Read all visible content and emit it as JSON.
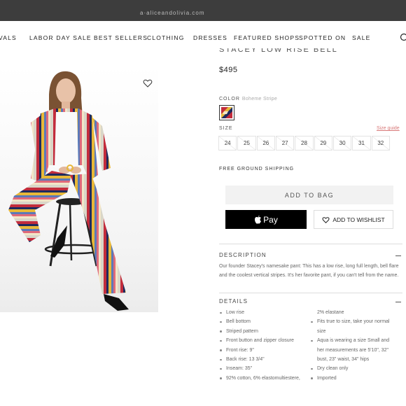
{
  "topbar": {
    "text": "a·aliceandolivia.com"
  },
  "nav": {
    "items": [
      "VALS",
      "LABOR DAY SALE",
      "BEST SELLERS",
      "CLOTHING",
      "DRESSES",
      "FEATURED SHOPS",
      "SPOTTED ON",
      "SALE"
    ]
  },
  "product": {
    "title": "STACEY LOW RISE BELL",
    "price": "$495"
  },
  "color": {
    "label": "COLOR",
    "value": "Boheme Stripe"
  },
  "size": {
    "label": "SIZE",
    "guide": "Size guide",
    "options": [
      "24",
      "25",
      "26",
      "27",
      "28",
      "29",
      "30",
      "31",
      "32"
    ]
  },
  "shipping": "FREE GROUND SHIPPING",
  "buttons": {
    "add_to_bag": "ADD TO BAG",
    "apple_pay": "Pay",
    "wishlist": "ADD TO WISHLIST"
  },
  "description": {
    "title": "DESCRIPTION",
    "text": "Our founder Stacey's namesake pant: This has a low rise, long full length, bell flare and the coolest vertical stripes. It's her favorite pant, if you can't tell from the name."
  },
  "details": {
    "title": "DETAILS",
    "col1": [
      "Low rise",
      "Bell bottom",
      "Striped pattern",
      "Front button and zipper closure",
      "Front rise: 9\"",
      "Back rise: 13 3/4\"",
      "Inseam: 35\"",
      "92% cotton, 6% elastomultiestere,"
    ],
    "col2": [
      {
        "text": "2% elastane",
        "bullet": false
      },
      {
        "text": "Fits true to size, take your normal",
        "bullet": true
      },
      {
        "text": "size",
        "bullet": false
      },
      {
        "text": "Aqua is wearing a size Small and",
        "bullet": true
      },
      {
        "text": "her measurements are 5'10\", 32\"",
        "bullet": false
      },
      {
        "text": "bust, 23\" waist, 34\" hips",
        "bullet": false
      },
      {
        "text": "Dry clean only",
        "bullet": true
      },
      {
        "text": "Imported",
        "bullet": true
      }
    ]
  },
  "colors": {
    "brand_black": "#000000",
    "size_guide": "#d87878",
    "stripe_red": "#c22c3c",
    "stripe_yellow": "#e8b838",
    "stripe_navy": "#1e2b5e"
  }
}
